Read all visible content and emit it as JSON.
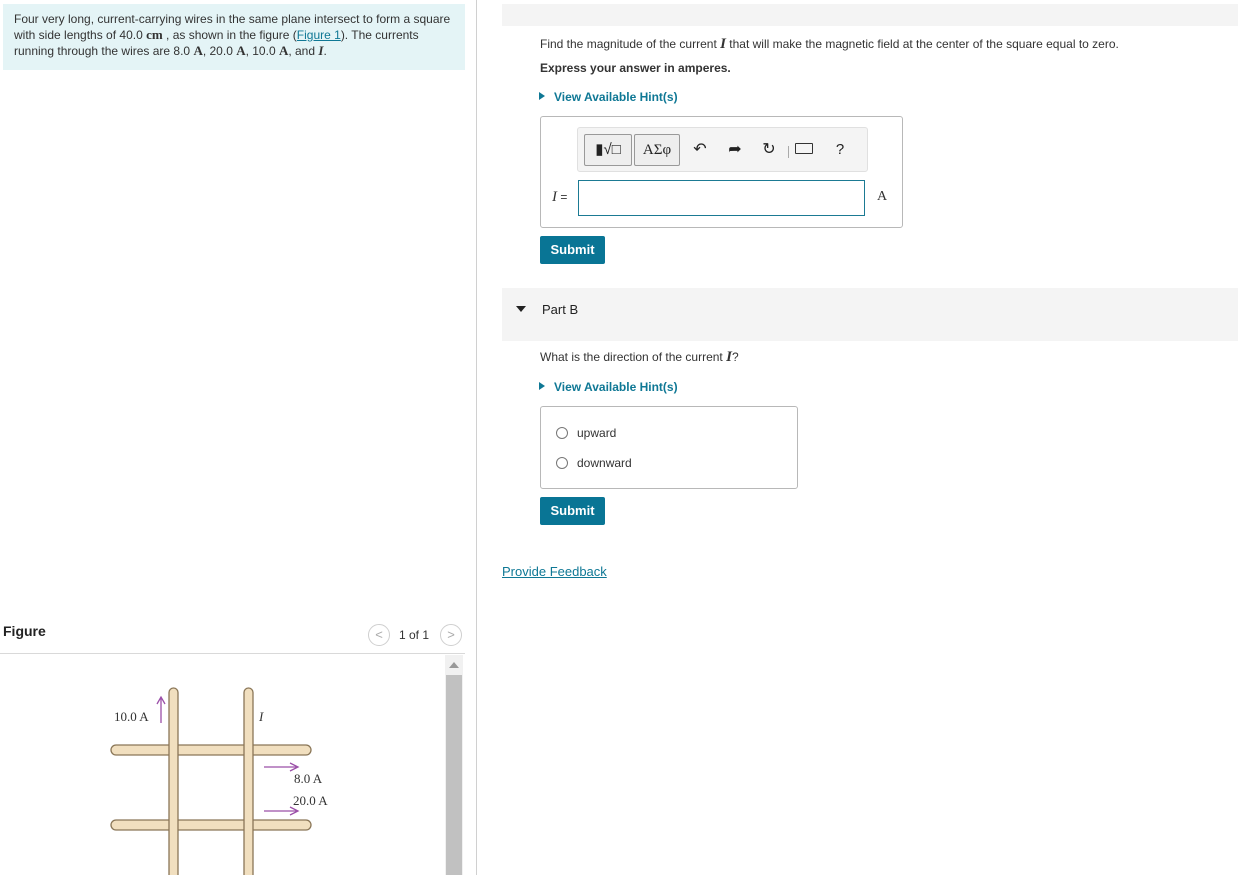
{
  "problem": {
    "t1": "Four very long, current-carrying wires in the same plane intersect to form a square with side lengths of 40.0 ",
    "u_cm": "cm",
    "t2": " , as shown in the figure (",
    "fig_link": "Figure 1",
    "t3": "). The currents running through the wires are 8.0 ",
    "u_a1": "A",
    "t4": ", 20.0 ",
    "u_a2": "A",
    "t5": ", 10.0 ",
    "u_a3": "A",
    "t6": ", and ",
    "var": "I",
    "t7": "."
  },
  "figure_panel": {
    "title": "Figure",
    "prev_icon": "<",
    "next_icon": ">",
    "counter": "1 of 1",
    "labels": {
      "current_10": "10.0 A",
      "current_I": "I",
      "current_8": "8.0 A",
      "current_20": "20.0 A"
    },
    "colors": {
      "wire_fill": "#f1dfbf",
      "wire_stroke": "#8a7657",
      "arrow": "#9b4fa8"
    }
  },
  "partA": {
    "q_pre": "Find the magnitude of the current ",
    "q_var": "I",
    "q_post": " that will make the magnetic field at the center of the square equal to zero.",
    "instruction": "Express your answer in amperes.",
    "hints": "View Available Hint(s)",
    "toolbar": {
      "templates_glyph": "▮√□",
      "greek_glyph": "ΑΣφ",
      "undo_glyph": "↶",
      "redo_glyph": "➦",
      "reset_glyph": "↻",
      "help_glyph": "?"
    },
    "answer_var": "I",
    "answer_eq": " =",
    "answer_value": "",
    "unit": "A",
    "submit": "Submit"
  },
  "partB": {
    "title": "Part B",
    "q_pre": "What is the direction of the current ",
    "q_var": "I",
    "q_post": "?",
    "hints": "View Available Hint(s)",
    "choices": [
      "upward",
      "downward"
    ],
    "submit": "Submit"
  },
  "feedback": "Provide Feedback",
  "colors": {
    "accent": "#097595",
    "link": "#0f7895",
    "problem_bg": "#e4f4f6"
  }
}
